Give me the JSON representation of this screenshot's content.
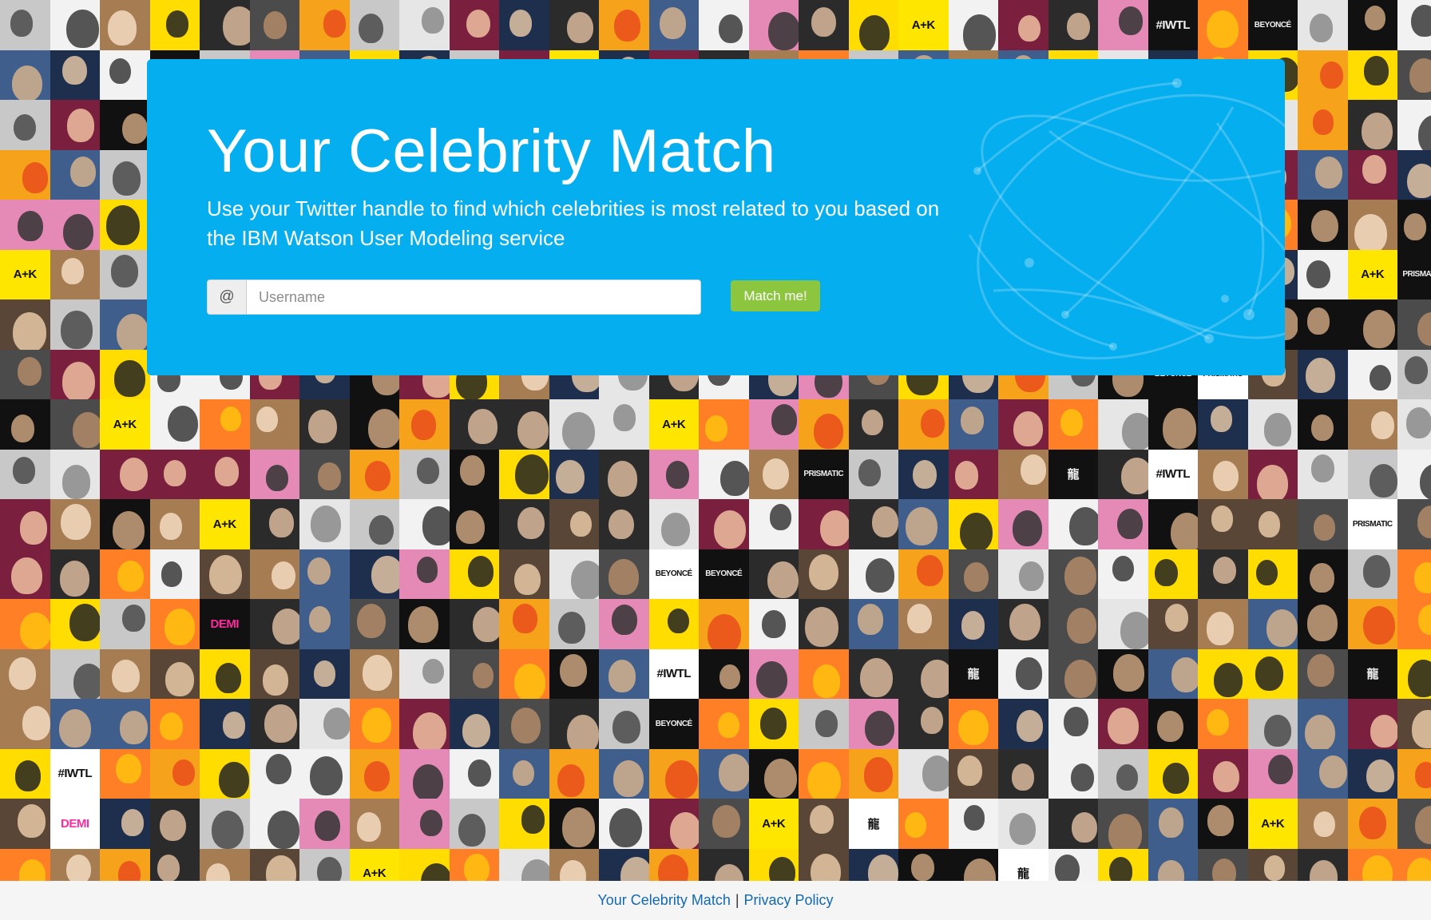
{
  "hero": {
    "title": "Your Celebrity Match",
    "subtitle": "Use your Twitter handle to find which celebrities is most related to you based on the IBM Watson User Modeling service",
    "at_symbol": "@",
    "username_placeholder": "Username",
    "match_button_label": "Match me!"
  },
  "footer": {
    "link_home": "Your Celebrity Match",
    "separator": "|",
    "link_privacy": "Privacy Policy"
  },
  "mosaic_labels": [
    "#IWTL",
    "BEYONCÉ",
    "A+K",
    "DEMI",
    "龍",
    "PRISMATIC"
  ],
  "colors": {
    "hero_blue": "#04aeef",
    "button_green": "#8cc63f",
    "footer_link": "#1369b1"
  }
}
